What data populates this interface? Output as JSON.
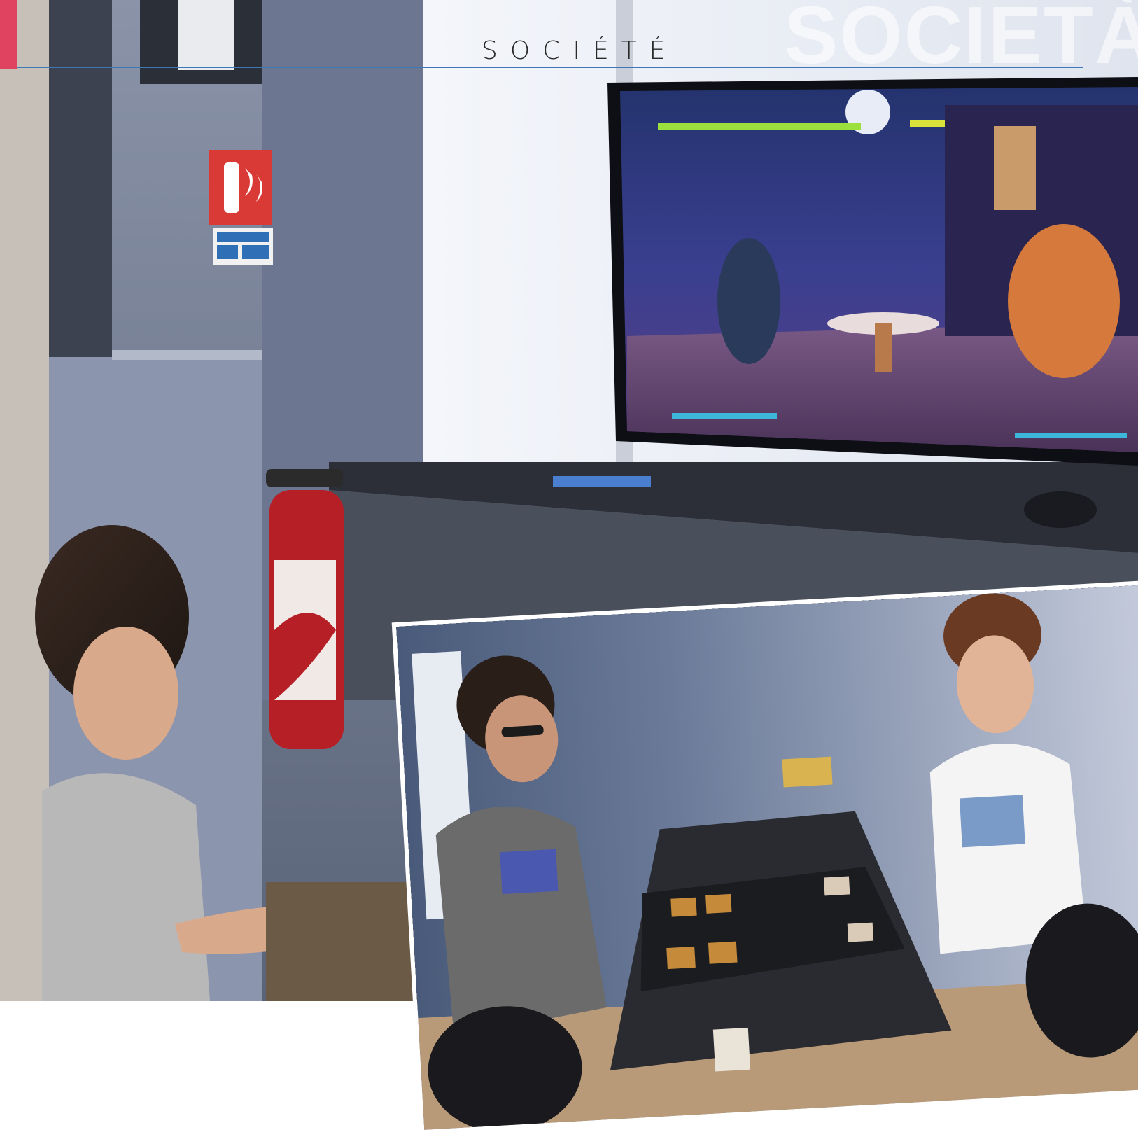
{
  "header": {
    "section_title": "SOCIÉTÉ",
    "watermark": "SOCIETÀ"
  },
  "colors": {
    "accent": "#e0435f",
    "rule": "#3b78b5"
  },
  "images": {
    "main_photo": "photo-gaming-room-tv",
    "inset_photo": "photo-card-game-table"
  }
}
